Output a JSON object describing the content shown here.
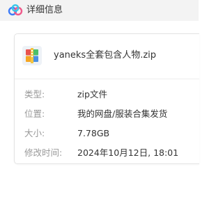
{
  "window": {
    "title": "详细信息",
    "app_icon": "cloud-logo-icon"
  },
  "file": {
    "icon": "zip-file-icon",
    "name": "yaneks全套包含人物.zip"
  },
  "details": {
    "type_label": "类型:",
    "type_value": "zip文件",
    "location_label": "位置:",
    "location_value": "我的网盘/服装合集发货",
    "size_label": "大小:",
    "size_value": "7.78GB",
    "modified_label": "修改时间:",
    "modified_value": "2024年10月12日, 18:01"
  },
  "colors": {
    "logo_blue": "#3d7bf7",
    "logo_cyan": "#39c7e8",
    "logo_pink": "#f05a8b",
    "zip_red": "#e8534e",
    "zip_orange": "#f5a623",
    "zip_green": "#4cbf6b",
    "zip_blue": "#4a90e2"
  }
}
